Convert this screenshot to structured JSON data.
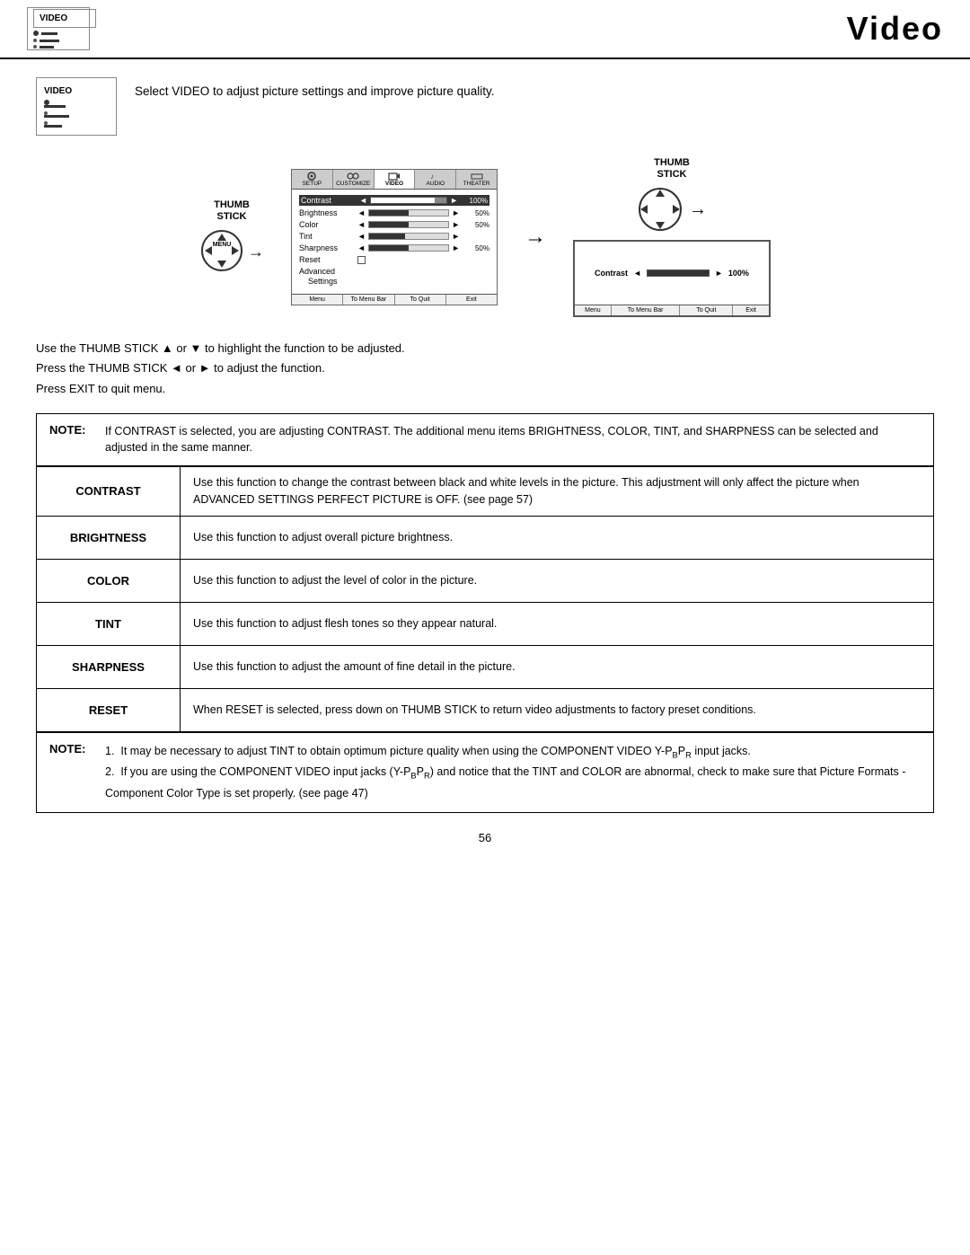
{
  "header": {
    "title": "Video",
    "icon_label": "VIDEO"
  },
  "intro": {
    "text": "Select VIDEO to adjust picture settings and improve picture quality."
  },
  "diagram": {
    "thumb_label_left": "THUMB\nSTICK",
    "thumb_label_right": "THUMB\nSTICK",
    "menu_tabs": [
      "SETUP",
      "CUSTOMIZE",
      "VIDEO",
      "AUDIO",
      "THEATER"
    ],
    "menu_rows": [
      {
        "label": "Contrast",
        "value": "100%",
        "fill": 85
      },
      {
        "label": "Brightness",
        "value": "50%",
        "fill": 50
      },
      {
        "label": "Color",
        "value": "50%",
        "fill": 50
      },
      {
        "label": "Tint",
        "value": "",
        "fill": 45
      },
      {
        "label": "Sharpness",
        "value": "50%",
        "fill": 50
      },
      {
        "label": "Reset",
        "value": "",
        "fill": 0,
        "checkbox": true
      },
      {
        "label": "Advanced",
        "value": "",
        "fill": 0,
        "blank": true
      },
      {
        "label": "Settings",
        "value": "",
        "fill": 0,
        "blank": true
      }
    ],
    "footer_items": [
      "Menu",
      "To Menu Bar",
      "To Quit",
      "Exit"
    ],
    "right_contrast_label": "Contrast",
    "right_contrast_value": "100%"
  },
  "instructions": [
    "Use the THUMB STICK ▲ or ▼ to highlight the function to be adjusted.",
    "Press the THUMB STICK ◄ or ► to adjust the function.",
    "Press EXIT to quit menu."
  ],
  "note1": {
    "label": "NOTE:",
    "text": "If CONTRAST is selected, you are adjusting CONTRAST.  The additional menu items BRIGHTNESS, COLOR, TINT, and SHARPNESS can be selected and adjusted in the same manner."
  },
  "functions": [
    {
      "label": "CONTRAST",
      "desc": "Use this function to change the contrast between black and white levels in the picture.  This adjustment will only affect the picture when ADVANCED SETTINGS PERFECT PICTURE is OFF. (see page 57)"
    },
    {
      "label": "BRIGHTNESS",
      "desc": "Use this function to adjust overall picture brightness."
    },
    {
      "label": "COLOR",
      "desc": "Use this function to adjust the level of color in the picture."
    },
    {
      "label": "TINT",
      "desc": "Use this function to adjust flesh tones so they appear natural."
    },
    {
      "label": "SHARPNESS",
      "desc": "Use this function to adjust the amount of fine detail in the picture."
    },
    {
      "label": "RESET",
      "desc": "When RESET is selected, press down on THUMB STICK to return video adjustments to factory preset conditions."
    }
  ],
  "note2": {
    "label": "NOTE:",
    "items": [
      "1.  It may be necessary to adjust TINT to obtain optimum picture quality when using the COMPONENT VIDEO Y-P_B P_R input jacks.",
      "2.  If you are using the COMPONENT VIDEO input jacks (Y-P_B P_R) and notice that the TINT and COLOR are abnormal, check to make sure that Picture Formats - Component Color Type is set properly. (see page 47)"
    ]
  },
  "page_number": "56"
}
